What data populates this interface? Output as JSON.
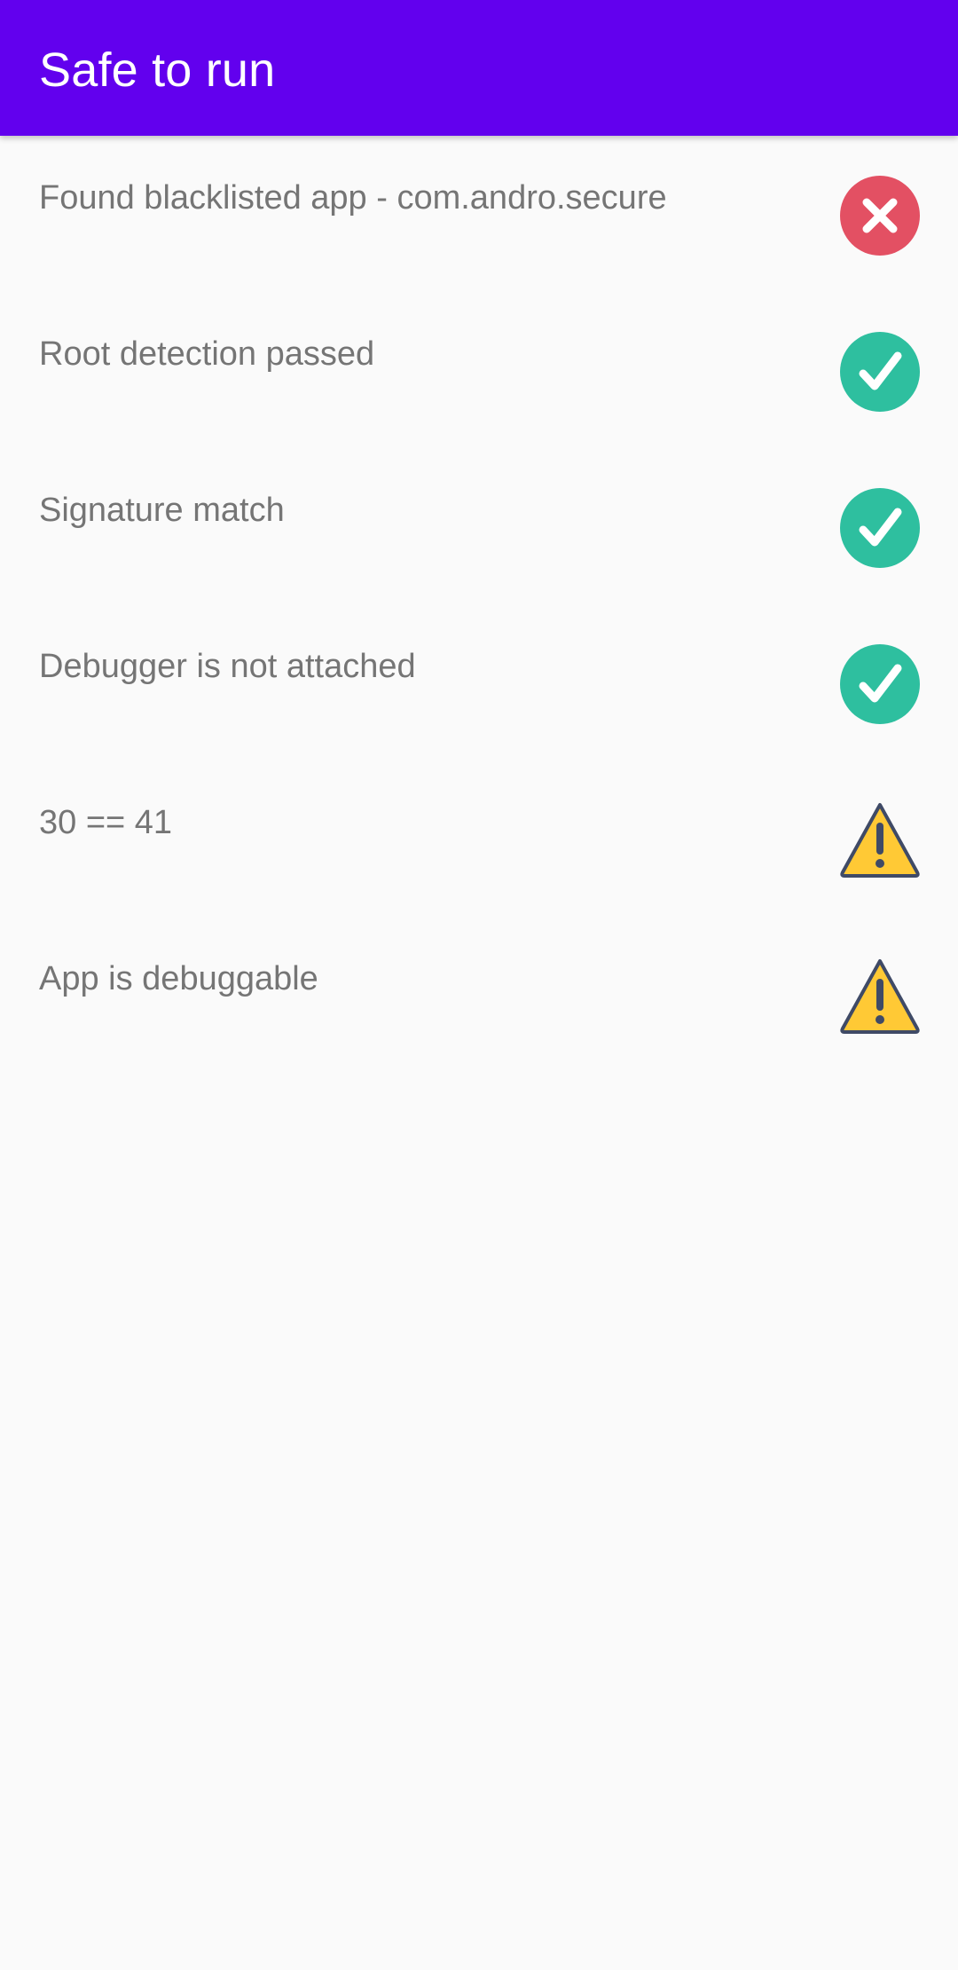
{
  "app_bar": {
    "title": "Safe to run",
    "color": "#6200ee"
  },
  "checks": [
    {
      "label": "Found blacklisted app - com.andro.secure",
      "status": "fail",
      "icon": "error-circle-icon"
    },
    {
      "label": "Root detection passed",
      "status": "pass",
      "icon": "check-circle-icon"
    },
    {
      "label": "Signature match",
      "status": "pass",
      "icon": "check-circle-icon"
    },
    {
      "label": "Debugger is not attached",
      "status": "pass",
      "icon": "check-circle-icon"
    },
    {
      "label": "30 == 41",
      "status": "warning",
      "icon": "warning-triangle-icon"
    },
    {
      "label": "App is debuggable",
      "status": "warning",
      "icon": "warning-triangle-icon"
    }
  ],
  "colors": {
    "fail": "#e35063",
    "pass": "#2ebf9f",
    "warning_fill": "#ffc935",
    "warning_stroke": "#3f4a66",
    "background": "#fafafa",
    "label_text": "#757575"
  }
}
